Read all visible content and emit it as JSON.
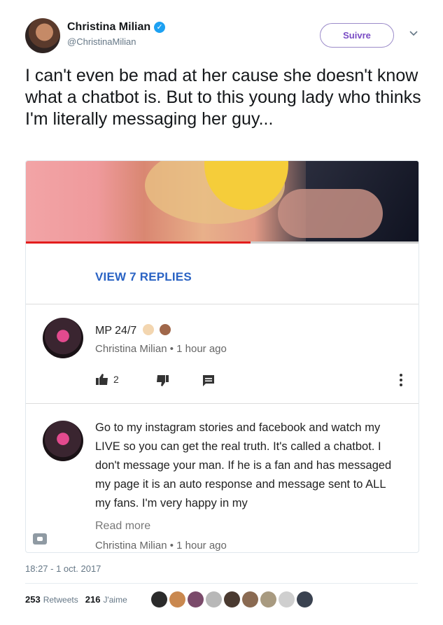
{
  "header": {
    "display_name": "Christina Milian",
    "verified": "✓",
    "handle": "@ChristinaMilian",
    "follow_label": "Suivre"
  },
  "tweet": {
    "text": "I can't even be mad at her cause she doesn't know what a chatbot is. But to this young lady who thinks I'm literally messaging her guy..."
  },
  "embedded": {
    "video_progress": 0.57,
    "replies_link": "VIEW 7 REPLIES",
    "comment1": {
      "name": "MP 24/7",
      "meta": "Christina Milian • 1 hour ago",
      "likes": "2"
    },
    "comment2": {
      "body": "Go to my instagram stories and facebook and watch my LIVE so you can get the real truth. It's called a chatbot. I don't message your man. If he is a fan and has messaged my page it is an auto response and message sent to ALL my fans. I'm very happy in my",
      "read_more": "Read more",
      "meta": "Christina Milian • 1 hour ago"
    }
  },
  "footer": {
    "timestamp": "18:27 - 1 oct. 2017",
    "retweets_count": "253",
    "retweets_label": "Retweets",
    "likes_count": "216",
    "likes_label": "J'aime"
  },
  "colors": {
    "follow_accent": "#794bc4",
    "link_blue": "#2a63c4",
    "verified_blue": "#1da1f2",
    "progress_red": "#e31d1d"
  }
}
